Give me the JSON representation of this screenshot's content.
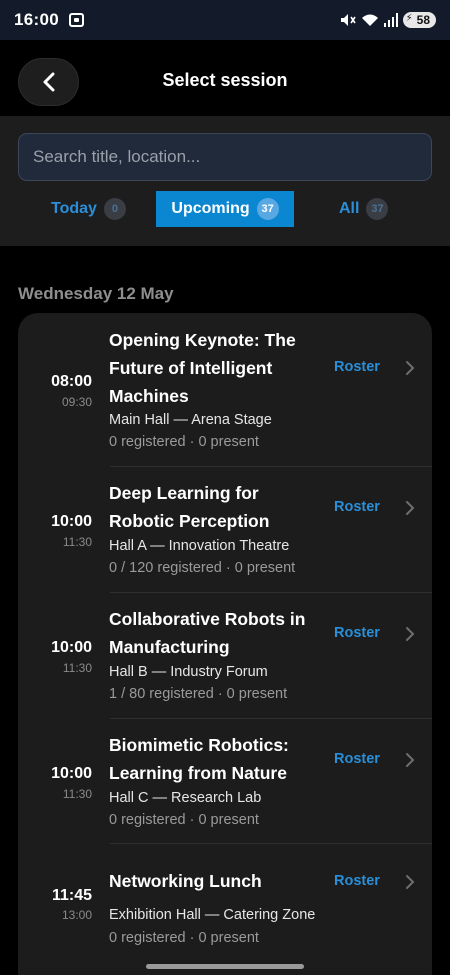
{
  "status_bar": {
    "time": "16:00",
    "battery": "58",
    "icons": [
      "screenshot-icon",
      "mute-icon",
      "wifi-icon",
      "signal-icon",
      "battery-icon"
    ]
  },
  "header": {
    "title": "Select session",
    "back_icon": "chevron-left-icon"
  },
  "search": {
    "placeholder": "Search title, location...",
    "value": ""
  },
  "tabs": [
    {
      "label": "Today",
      "count": "0",
      "active": false
    },
    {
      "label": "Upcoming",
      "count": "37",
      "active": true
    },
    {
      "label": "All",
      "count": "37",
      "active": false
    }
  ],
  "date_heading": "Wednesday 12 May",
  "sessions": [
    {
      "start": "08:00",
      "end": "09:30",
      "title": "Opening Keynote: The Future of Intelligent Machines",
      "location": "Main Hall — Arena Stage",
      "counts": "0 registered · 0 present",
      "action": "Roster"
    },
    {
      "start": "10:00",
      "end": "11:30",
      "title": "Deep Learning for Robotic Perception",
      "location": "Hall A — Innovation Theatre",
      "counts": "0 / 120 registered · 0 present",
      "action": "Roster"
    },
    {
      "start": "10:00",
      "end": "11:30",
      "title": "Collaborative Robots in Manufacturing",
      "location": "Hall B — Industry Forum",
      "counts": "1 / 80 registered · 0 present",
      "action": "Roster"
    },
    {
      "start": "10:00",
      "end": "11:30",
      "title": "Biomimetic Robotics: Learning from Nature",
      "location": "Hall C — Research Lab",
      "counts": "0 registered · 0 present",
      "action": "Roster"
    },
    {
      "start": "11:45",
      "end": "13:00",
      "title": "Networking Lunch",
      "location": "Exhibition Hall — Catering Zone",
      "counts": "0 registered · 0 present",
      "action": "Roster"
    }
  ],
  "colors": {
    "accent": "#0b86d0",
    "link": "#2a8ed8",
    "background": "#000000",
    "card": "#1c1c1c",
    "panel": "#1d1d1d"
  }
}
